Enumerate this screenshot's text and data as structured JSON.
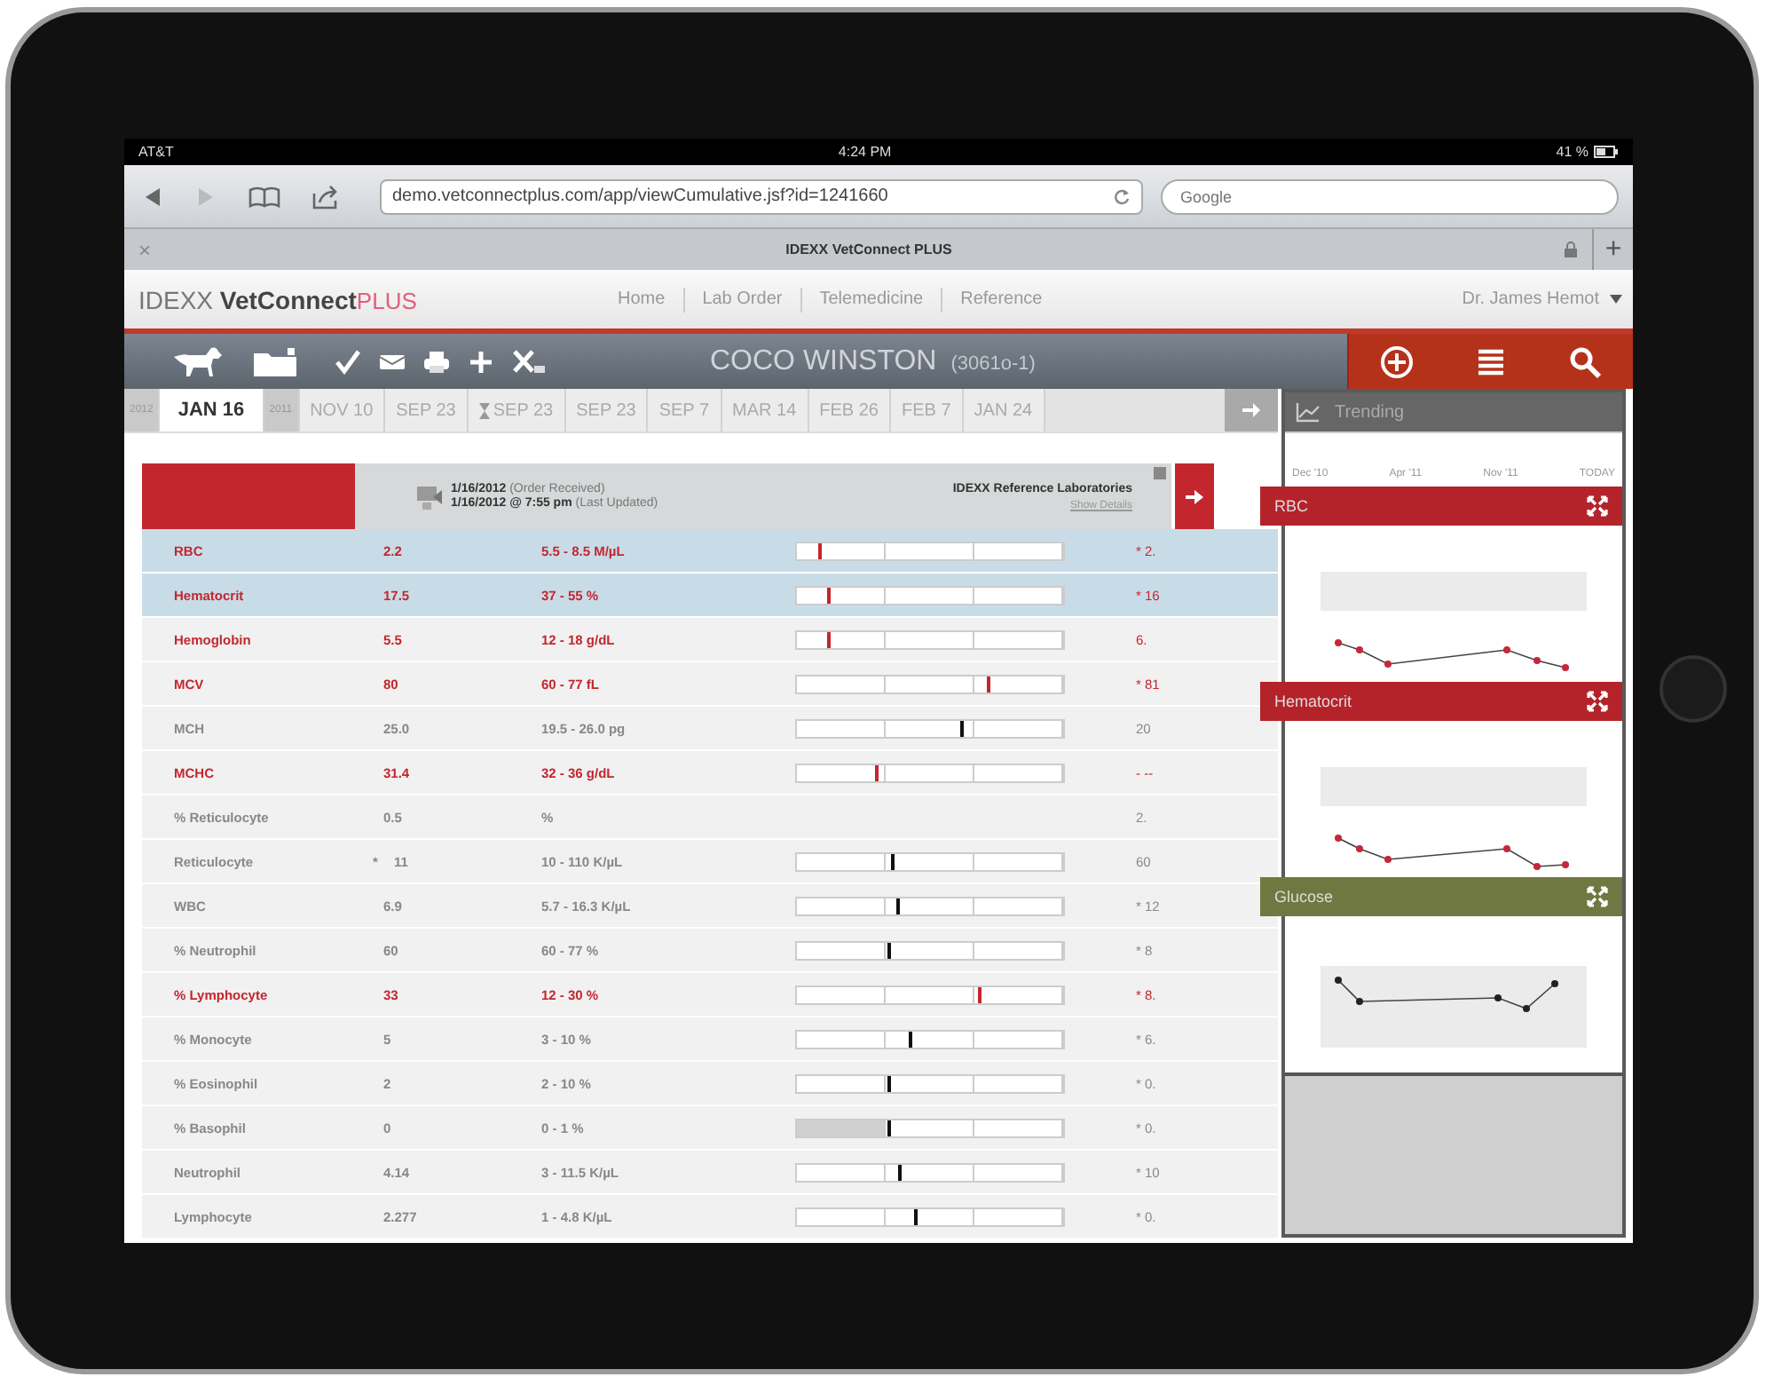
{
  "status_bar": {
    "carrier": "AT&T",
    "time": "4:24 PM",
    "battery": "41 %"
  },
  "browser": {
    "url": "demo.vetconnectplus.com/app/viewCumulative.jsf?id=1241660",
    "search": {
      "placeholder": "Google"
    },
    "tab_close": "×",
    "tab_title": "IDEXX VetConnect PLUS",
    "new_tab": "+"
  },
  "site_header": {
    "logo": {
      "brand": "IDEXX",
      "product": "VetConnect",
      "suffix": "PLUS"
    },
    "nav": [
      {
        "label": "Home"
      },
      {
        "label": "Lab Order"
      },
      {
        "label": "Telemedicine"
      },
      {
        "label": "Reference"
      }
    ],
    "user": "Dr. James Hemot"
  },
  "patient_bar": {
    "name": "COCO WINSTON",
    "id": "(3061o-1)"
  },
  "date_tabs": [
    {
      "label": "2012",
      "kind": "year",
      "selected": false
    },
    {
      "label": "JAN 16",
      "kind": "date",
      "selected": true
    },
    {
      "label": "2011",
      "kind": "year",
      "selected": false
    },
    {
      "label": "NOV 10",
      "kind": "date",
      "selected": false
    },
    {
      "label": "SEP 23",
      "kind": "date",
      "selected": false
    },
    {
      "label": "SEP 23",
      "kind": "pending",
      "selected": false
    },
    {
      "label": "SEP 23",
      "kind": "date",
      "selected": false
    },
    {
      "label": "SEP 7",
      "kind": "date",
      "selected": false
    },
    {
      "label": "MAR 14",
      "kind": "date",
      "selected": false
    },
    {
      "label": "FEB 26",
      "kind": "date",
      "selected": false
    },
    {
      "label": "FEB 7",
      "kind": "date",
      "selected": false
    },
    {
      "label": "JAN 24",
      "kind": "date",
      "selected": false
    }
  ],
  "results": {
    "header": {
      "order_date": "1/16/2012",
      "order_note": "(Order Received)",
      "updated": "1/16/2012 @ 7:55 pm",
      "updated_note": "(Last Updated)",
      "lab": "IDEXX Reference Laboratories",
      "details_link": "Show Details"
    },
    "rows": [
      {
        "name": "RBC",
        "value": "2.2",
        "range": "5.5 - 8.5 M/µL",
        "level": 0.08,
        "abnormal": true,
        "selected": true,
        "previous": "* 2."
      },
      {
        "name": "Hematocrit",
        "value": "17.5",
        "range": "37 - 55 %",
        "level": 0.11,
        "abnormal": true,
        "selected": true,
        "previous": "* 16"
      },
      {
        "name": "Hemoglobin",
        "value": "5.5",
        "range": "12 - 18 g/dL",
        "level": 0.11,
        "abnormal": true,
        "selected": false,
        "previous": "6."
      },
      {
        "name": "MCV",
        "value": "80",
        "range": "60 - 77 fL",
        "level": 0.71,
        "abnormal": true,
        "selected": false,
        "previous": "* 81"
      },
      {
        "name": "MCH",
        "value": "25.0",
        "range": "19.5 - 26.0 pg",
        "level": 0.61,
        "abnormal": false,
        "selected": false,
        "previous": "20"
      },
      {
        "name": "MCHC",
        "value": "31.4",
        "range": "32 - 36 g/dL",
        "level": 0.29,
        "abnormal": true,
        "selected": false,
        "previous": "- --"
      },
      {
        "name": "% Reticulocyte",
        "value": "0.5",
        "range": "%",
        "abnormal": false,
        "selected": false,
        "previous": "2."
      },
      {
        "name": "Reticulocyte",
        "note": "*",
        "value": "11",
        "range": "10 - 110 K/µL",
        "level": 0.35,
        "abnormal": false,
        "selected": false,
        "previous": "60"
      },
      {
        "name": "WBC",
        "value": "6.9",
        "range": "5.7 - 16.3 K/µL",
        "level": 0.37,
        "abnormal": false,
        "selected": false,
        "previous": "* 12"
      },
      {
        "name": "% Neutrophil",
        "value": "60",
        "range": "60 - 77 %",
        "level": 0.34,
        "abnormal": false,
        "selected": false,
        "previous": "* 8"
      },
      {
        "name": "% Lymphocyte",
        "value": "33",
        "range": "12 - 30 %",
        "level": 0.68,
        "abnormal": true,
        "selected": false,
        "previous": "* 8."
      },
      {
        "name": "% Monocyte",
        "value": "5",
        "range": "3 - 10 %",
        "level": 0.42,
        "abnormal": false,
        "selected": false,
        "previous": "* 6."
      },
      {
        "name": "% Eosinophil",
        "value": "2",
        "range": "2 - 10 %",
        "level": 0.34,
        "abnormal": false,
        "selected": false,
        "previous": "* 0."
      },
      {
        "name": "% Basophil",
        "value": "0",
        "range": "0 - 1 %",
        "level": 0.34,
        "abnormal": false,
        "selected": false,
        "shaded": true,
        "previous": "* 0."
      },
      {
        "name": "Neutrophil",
        "value": "4.14",
        "range": "3 - 11.5 K/µL",
        "level": 0.38,
        "abnormal": false,
        "selected": false,
        "previous": "* 10"
      },
      {
        "name": "Lymphocyte",
        "value": "2.277",
        "range": "1 - 4.8 K/µL",
        "level": 0.44,
        "abnormal": false,
        "selected": false,
        "previous": "* 0."
      }
    ]
  },
  "trending": {
    "title": "Trending",
    "axis_labels": [
      "Dec '10",
      "Apr '11",
      "Nov '11",
      "TODAY"
    ],
    "cards": [
      {
        "title": "RBC",
        "color": "#b5232a",
        "flagged": true
      },
      {
        "title": "Hematocrit",
        "color": "#b5232a",
        "flagged": true
      },
      {
        "title": "Glucose",
        "color": "#6f7840",
        "flagged": false
      }
    ]
  }
}
